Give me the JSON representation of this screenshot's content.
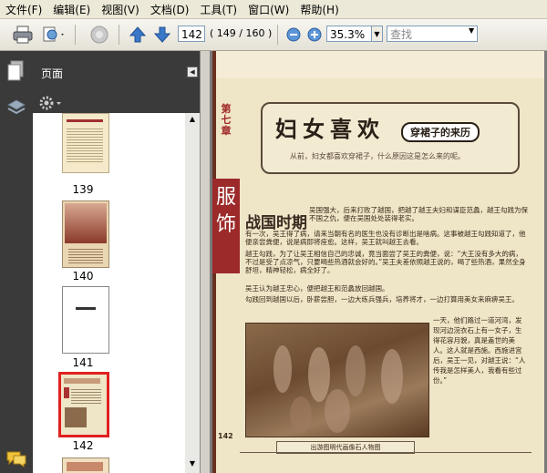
{
  "menu": [
    "文件(F)",
    "编辑(E)",
    "视图(V)",
    "文档(D)",
    "工具(T)",
    "窗口(W)",
    "帮助(H)"
  ],
  "toolbar": {
    "current_page": "142",
    "page_count": "( 149 / 160 )",
    "zoom": "35.3%",
    "find_placeholder": "查找"
  },
  "panel": {
    "title": "页面",
    "thumbnails": [
      {
        "label": "139"
      },
      {
        "label": "140"
      },
      {
        "label": "141"
      },
      {
        "label": "142"
      }
    ]
  },
  "document": {
    "chapter": "第七章",
    "headline": "妇女喜欢",
    "subheadline": "穿裙子的来历",
    "intro": "从前，妇女都喜欢穿裙子，什么原因这是怎么来的呢。",
    "section_title": "服饰",
    "heading": "战国时期",
    "para1": "吴国强大，后来打败了越国，把越了越王夫妇和谋臣范蠡，越王勾践为保不国之仇，便在吴国处处装得老实。",
    "para2": "有一次，吴王得了病，请来当朝有名的医生也没有诊断出是啥病。这事被越王勾践知道了，他便亲尝粪便，说是病即将痊愈。这样，吴王就叫越王去看。",
    "para3": "越王勾践，为了让吴王相信自己的忠诚，竟当面尝了吴王的粪便，说：“大王没有多大的病，不过是受了点凉气，只要喝些热酒就会好的。”吴王夫差依照越王说的，喝了些热酒，果然全身舒坦，精神轻松，病全好了。",
    "para4": "吴王认为越王忠心，便把越王和范蠡放回越国。",
    "para5": "勾践回到越国以后，卧薪尝胆，一边大练兵强兵，培养将才，一边打算用美女来麻痹吴王。",
    "sidetext": "一天，他们路过一道河湾，发现河边浣衣石上有一女子，生得花容月貌，真是盖世的美人。这人就是西施。西施进宫后，吴王一见，对越王说：“人传我是怎样美人，我看有些过份。”",
    "caption": "出游图明代画像石人物图",
    "page_number": "142"
  }
}
